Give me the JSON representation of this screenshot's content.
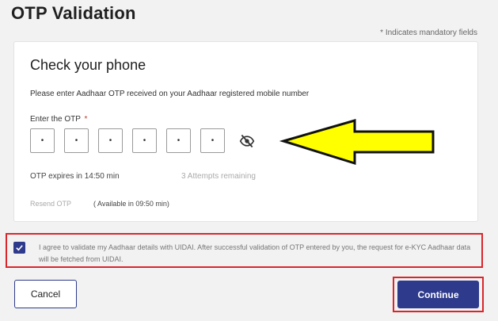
{
  "header": {
    "title": "OTP Validation",
    "mandatory_note": "* Indicates mandatory fields"
  },
  "card": {
    "title": "Check your phone",
    "subtitle": "Please enter Aadhaar OTP received on your Aadhaar registered mobile number",
    "otp_label": "Enter the OTP",
    "otp_required_mark": "*",
    "otp_digits": [
      "•",
      "•",
      "•",
      "•",
      "•",
      "•"
    ],
    "visibility_icon": "eye-off-icon",
    "expires_text": "OTP expires in 14:50 min",
    "attempts_text": "3 Attempts remaining",
    "resend_label": "Resend OTP",
    "available_text": "( Available in 09:50 min)"
  },
  "annotation": {
    "arrow_color": "#ffff00"
  },
  "consent": {
    "checked": true,
    "text": "I agree to validate my Aadhaar details with UIDAI. After successful validation of OTP entered by you, the request for e-KYC Aadhaar data will be fetched from UIDAI."
  },
  "actions": {
    "cancel_label": "Cancel",
    "continue_label": "Continue"
  },
  "colors": {
    "primary": "#2e3a8c",
    "highlight": "#d9262b"
  }
}
